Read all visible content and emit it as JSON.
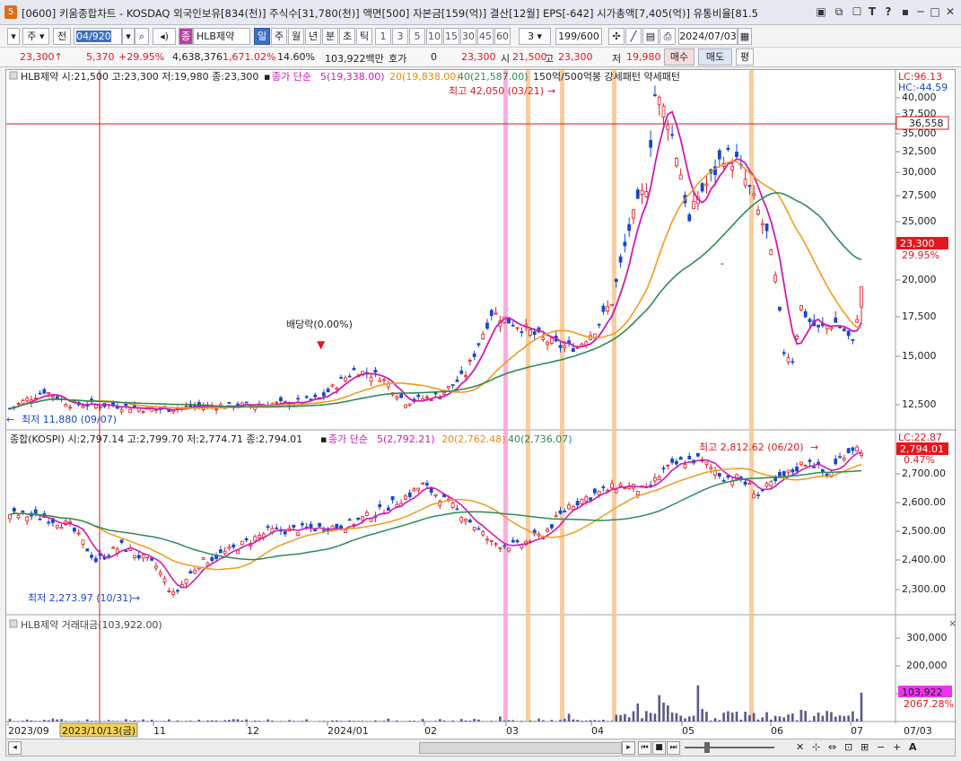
{
  "window": {
    "code": "[0600]",
    "title": "키움종합차트 - KOSDAQ 외국인보유[834(천)] 주식수[31,780(천)] 액면[500] 자본금[159(억)] 결산[12월] EPS[-642] 시가총액[7,405(억)] 유통비율[81.5",
    "icon_label": "5"
  },
  "toolbar": {
    "period_type": "주",
    "prev_label": "전",
    "date_value": "04/920",
    "stock_badge": "종",
    "stock_name": "HLB제약",
    "period_tabs": [
      "일",
      "주",
      "월",
      "년",
      "분",
      "초",
      "틱"
    ],
    "active_tab": "일",
    "interval_buttons": [
      "1",
      "3",
      "5",
      "10",
      "15",
      "30",
      "45",
      "60"
    ],
    "custom_interval": "3",
    "count": "199/600",
    "date": "2024/07/03"
  },
  "quote": {
    "price": "23,300",
    "change": "5,370",
    "change_pct": "+29.95%",
    "volume": "4,638,376",
    "vol_ratio": "1,671.02%",
    "turnover": "14.60%",
    "amount": "103,922백만",
    "hoga_label": "호가",
    "hoga_value": "0",
    "current": "23,300",
    "open_label": "시",
    "open": "21,500",
    "high_label": "고",
    "high": "23,300",
    "low_label": "저",
    "low": "19,980",
    "buy_label": "매수",
    "sell_label": "매도",
    "flat_label": "평"
  },
  "panel1": {
    "info": "HLB제약 시:21,500 고:23,300 저:19,980 종:23,300",
    "ma_label": "종가 단순",
    "ma5": "5(19,338.00)",
    "ma20": "20(19,838.00)",
    "ma40": "40(21,587.00)",
    "pattern": "150억/500억봉 강세패턴  약세패턴",
    "lc": "LC:96.13",
    "hc": "HC:-44.59",
    "high_note": "최고 42,050 (03/21)",
    "low_note": "최저 11,880 (09/07)",
    "dividend_note": "배당락(0.00%)",
    "cross_price": "36,558",
    "last_price": "23,300",
    "last_pct": "29.95%",
    "ticks": [
      "40,000",
      "37,500",
      "35,000",
      "32,500",
      "30,000",
      "27,500",
      "25,000",
      "20,000",
      "17,500",
      "15,000",
      "12,500"
    ]
  },
  "panel2": {
    "info": "종합(KOSPI) 시:2,797.14 고:2,799.70 저:2,774.71 종:2,794.01",
    "ma_label": "종가 단순",
    "ma5": "5(2,792.21)",
    "ma20": "20(2,762.48)",
    "ma40": "40(2,736.07)",
    "lc": "LC:22.87",
    "high_note": "최고 2,812.62 (06/20)",
    "low_note": "최저 2,273.97 (10/31)",
    "last_price": "2,794.01",
    "last_pct": "0.47%",
    "ticks": [
      "2,700.00",
      "2,600.00",
      "2,500.00",
      "2,400.00",
      "2,300.00"
    ]
  },
  "panel3": {
    "info": "HLB제약 거래대금(103,922.00)",
    "last_value": "103,922",
    "last_pct": "2067.28%",
    "ticks": [
      "300,000",
      "200,000",
      "100,000"
    ]
  },
  "xaxis": {
    "labels": [
      "2023/09",
      "2023/10/13(금)",
      "11",
      "12",
      "2024/01",
      "02",
      "03",
      "04",
      "05",
      "06",
      "07"
    ],
    "right_label": "07/03"
  },
  "colors": {
    "up": "#e0191e",
    "down": "#1847c8",
    "ma5": "#d01ab4",
    "ma20": "#f29a1c",
    "ma40": "#2e8b57",
    "highlight_orange": "#f7c48f",
    "highlight_pink": "#f4a3d9"
  }
}
